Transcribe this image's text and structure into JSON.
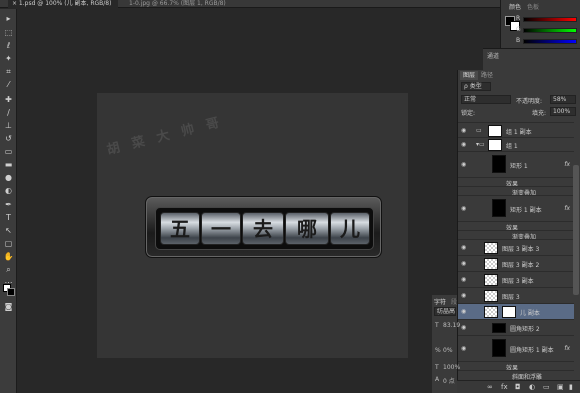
{
  "tabs": [
    {
      "label": "× 1.psd @ 100% (儿 副本, RGB/8)",
      "active": true
    },
    {
      "label": "1-0.jpg @ 66.7% (图层 1, RGB/8)",
      "active": false
    }
  ],
  "canvas": {
    "watermark": "胡 菜 大 帅 哥",
    "rollers": [
      "五",
      "一",
      "去",
      "哪",
      "儿"
    ]
  },
  "color_panel": {
    "tabs": [
      "颜色",
      "色板"
    ],
    "channels": [
      "R",
      "G",
      "B"
    ]
  },
  "channels_panel": {
    "label": "通道"
  },
  "layers_panel": {
    "tabs": [
      "图层",
      "路径"
    ],
    "filter_label": "ρ 类型",
    "blend_mode": "正常",
    "opacity_label": "不透明度:",
    "opacity_value": "58%",
    "lock_label": "锁定:",
    "fill_label": "填充:",
    "fill_value": "100%",
    "layers": [
      {
        "name": "组 1 副本",
        "kind": "group"
      },
      {
        "name": "组 1",
        "kind": "group-open"
      },
      {
        "name": "矩形 1",
        "kind": "shape",
        "fx": "fx"
      },
      {
        "name": "效果",
        "kind": "effect-head"
      },
      {
        "name": "渐变叠加",
        "kind": "effect"
      },
      {
        "name": "矩形 1 副本",
        "kind": "shape",
        "fx": "fx"
      },
      {
        "name": "效果",
        "kind": "effect-head"
      },
      {
        "name": "渐变叠加",
        "kind": "effect"
      },
      {
        "name": "图层 3 副本 3",
        "kind": "pixel"
      },
      {
        "name": "图层 3 副本 2",
        "kind": "pixel"
      },
      {
        "name": "图层 3 副本",
        "kind": "pixel"
      },
      {
        "name": "图层 3",
        "kind": "pixel"
      },
      {
        "name": "儿 副本",
        "kind": "selected"
      },
      {
        "name": "圆角矩形 2",
        "kind": "shape2"
      },
      {
        "name": "圆角矩形 1 副本",
        "kind": "shape",
        "fx": "fx"
      },
      {
        "name": "效果",
        "kind": "effect-head"
      },
      {
        "name": "斜面和浮雕",
        "kind": "effect"
      }
    ]
  },
  "char_panel": {
    "tabs": [
      "字符",
      "段"
    ],
    "font": "纺晶高铌",
    "size": "83.19",
    "tracking": "0%",
    "scale": "100%",
    "baseline": "0 点"
  }
}
